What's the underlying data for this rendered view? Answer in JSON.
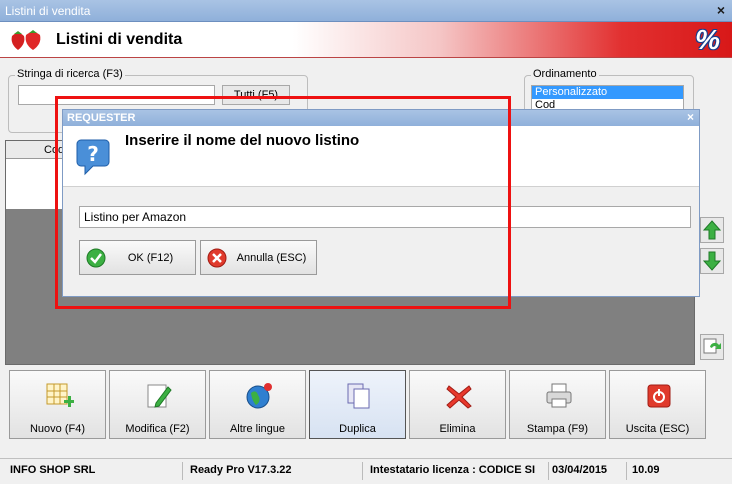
{
  "window": {
    "title": "Listini di vendita",
    "close": "×"
  },
  "header": {
    "title": "Listini di vendita",
    "percent_symbol": "%",
    "logo_icon": "strawberries-icon"
  },
  "search": {
    "label": "Stringa di ricerca (F3)",
    "value": "",
    "tutti_button": "Tutti (F5)"
  },
  "ordering": {
    "label": "Ordinamento",
    "options": [
      "Personalizzato",
      "Cod"
    ],
    "selected": "Personalizzato"
  },
  "table": {
    "headers": [
      "Cod"
    ]
  },
  "toolbar": {
    "buttons": [
      {
        "label": "Nuovo (F4)",
        "icon": "grid-add-icon"
      },
      {
        "label": "Modifica (F2)",
        "icon": "edit-pencil-icon"
      },
      {
        "label": "Altre lingue",
        "icon": "globe-icon"
      },
      {
        "label": "Duplica",
        "icon": "copy-icon"
      },
      {
        "label": "Elimina",
        "icon": "delete-x-icon"
      },
      {
        "label": "Stampa (F9)",
        "icon": "printer-icon"
      },
      {
        "label": "Uscita (ESC)",
        "icon": "exit-icon"
      }
    ]
  },
  "statusbar": {
    "company": "INFO SHOP SRL",
    "version": "Ready Pro V17.3.22",
    "license": "Intestatario licenza : CODICE SI",
    "date": "03/04/2015",
    "time": "10.09"
  },
  "dialog": {
    "title": "REQUESTER",
    "close": "×",
    "prompt": "Inserire il nome del nuovo listino",
    "input_value": "Listino per Amazon",
    "ok_button": "OK (F12)",
    "cancel_button": "Annulla (ESC)"
  },
  "colors": {
    "highlight": "#e11111",
    "header_red": "#d81818",
    "title_blue": "#8fb0da"
  }
}
